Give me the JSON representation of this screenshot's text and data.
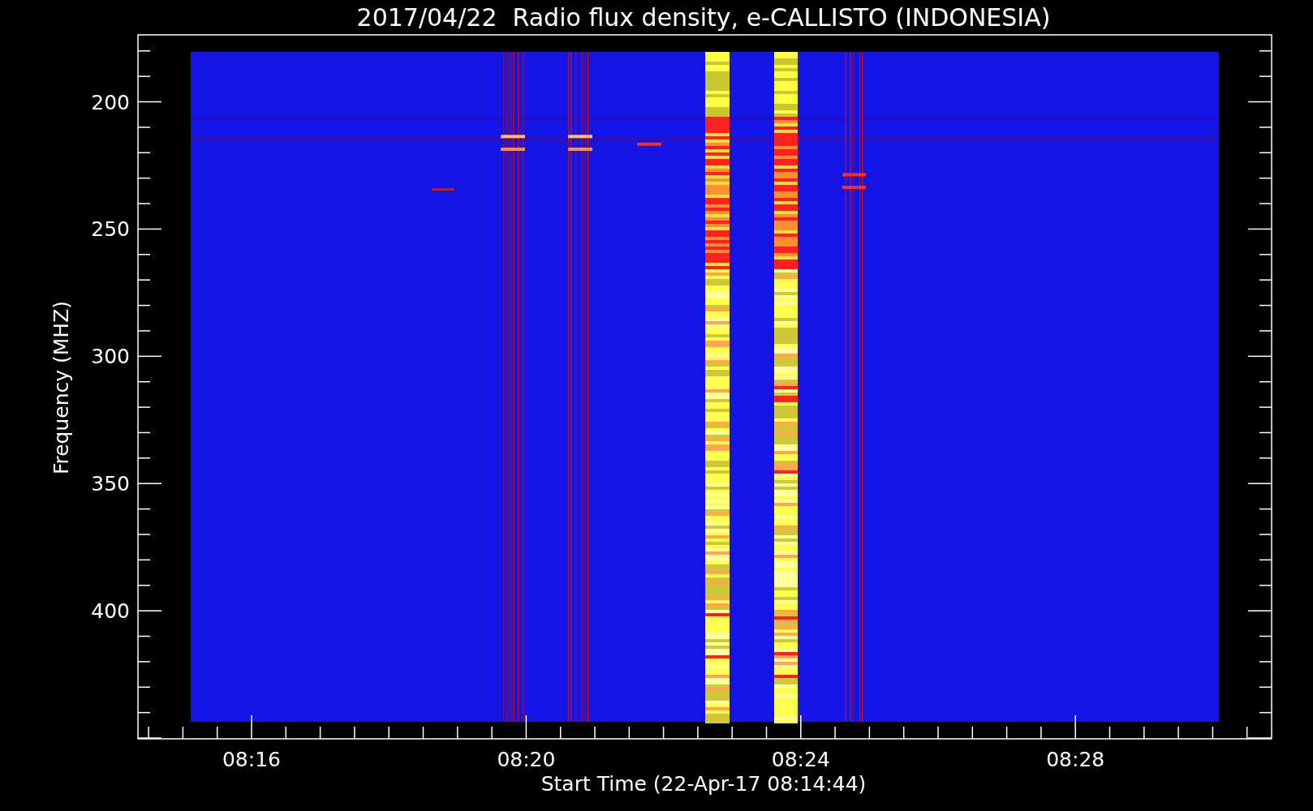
{
  "title": "2017/04/22  Radio flux density, e-CALLISTO (INDONESIA)",
  "plot": {
    "ylabel": "Frequency (MHZ)",
    "xlabel": "Start Time (22-Apr-17 08:14:44)",
    "yticks": [
      "200",
      "250",
      "300",
      "350",
      "400"
    ],
    "xticks": [
      "08:16",
      "08:20",
      "08:24",
      "08:28"
    ]
  }
}
